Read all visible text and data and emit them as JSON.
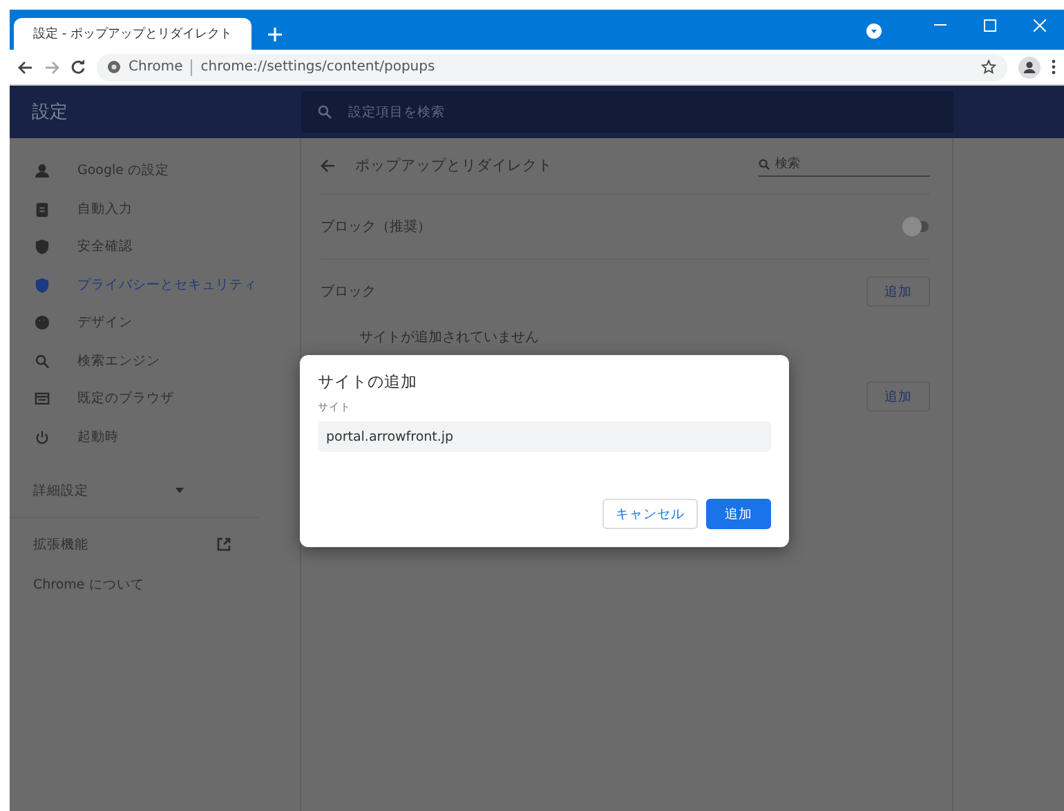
{
  "browser": {
    "tab_title": "設定 - ポップアップとリダイレクト",
    "site_label": "Chrome",
    "url": "chrome://settings/content/popups"
  },
  "header": {
    "title": "設定",
    "search_placeholder": "設定項目を検索"
  },
  "sidebar": {
    "items": [
      {
        "label": "Google の設定",
        "selected": false
      },
      {
        "label": "自動入力",
        "selected": false
      },
      {
        "label": "安全確認",
        "selected": false
      },
      {
        "label": "プライバシーとセキュリティ",
        "selected": true
      },
      {
        "label": "デザイン",
        "selected": false
      },
      {
        "label": "検索エンジン",
        "selected": false
      },
      {
        "label": "既定のブラウザ",
        "selected": false
      },
      {
        "label": "起動時",
        "selected": false
      }
    ],
    "advanced": {
      "label": "詳細設定",
      "expanded": false
    },
    "extensions": "拡張機能",
    "about": "Chrome について"
  },
  "page": {
    "title": "ポップアップとリダイレクト",
    "search_placeholder": "検索",
    "toggle": {
      "label": "ブロック（推奨）",
      "on": false
    },
    "block": {
      "label": "ブロック",
      "button": "追加",
      "empty": "サイトが追加されていません"
    },
    "allow": {
      "button": "追加"
    }
  },
  "dialog": {
    "title": "サイトの追加",
    "field_label": "サイト",
    "field_value": "portal.arrowfront.jp",
    "buttons": [
      {
        "label": "キャンセル",
        "kind": "secondary"
      },
      {
        "label": "追加",
        "kind": "primary"
      }
    ]
  }
}
